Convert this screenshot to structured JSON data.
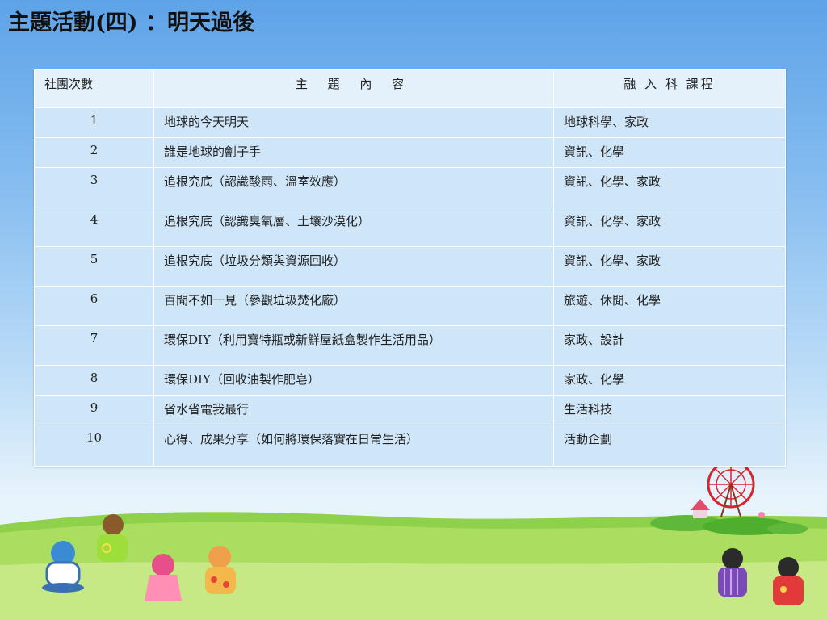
{
  "title": "主題活動(四) ：明天過後",
  "table": {
    "headers": [
      "社團次數",
      "主 題 內 容",
      "融 入 科 課程"
    ],
    "rows": [
      {
        "num": "1",
        "topic": "地球的今天明天",
        "subjects": "地球科學、家政"
      },
      {
        "num": "2",
        "topic": "誰是地球的劊子手",
        "subjects": "資訊、化學"
      },
      {
        "num": "3",
        "topic": "追根究底（認識酸雨、溫室效應）",
        "subjects": "資訊、化學、家政"
      },
      {
        "num": "4",
        "topic": "追根究底（認識臭氧層、土壤沙漠化）",
        "subjects": "資訊、化學、家政"
      },
      {
        "num": "5",
        "topic": "追根究底（垃圾分類與資源回收）",
        "subjects": "資訊、化學、家政"
      },
      {
        "num": "6",
        "topic": "百聞不如一見（參觀垃圾焚化廠）",
        "subjects": "旅遊、休閒、化學"
      },
      {
        "num": "7",
        "topic": "環保DIY（利用寶特瓶或新鮮屋紙盒製作生活用品）",
        "subjects": "家政、設計"
      },
      {
        "num": "8",
        "topic": "環保DIY（回收油製作肥皂）",
        "subjects": "家政、化學"
      },
      {
        "num": "9",
        "topic": "省水省電我最行",
        "subjects": "生活科技"
      },
      {
        "num": "10",
        "topic": "心得、成果分享（如何將環保落實在日常生活）",
        "subjects": " 活動企劃"
      }
    ]
  },
  "decor": {
    "grass_color": "#8fd14a",
    "sky_color": "#5ea3e8",
    "illustration": [
      "kids-sitting-left",
      "ferris-wheel",
      "kids-sitting-right"
    ]
  }
}
